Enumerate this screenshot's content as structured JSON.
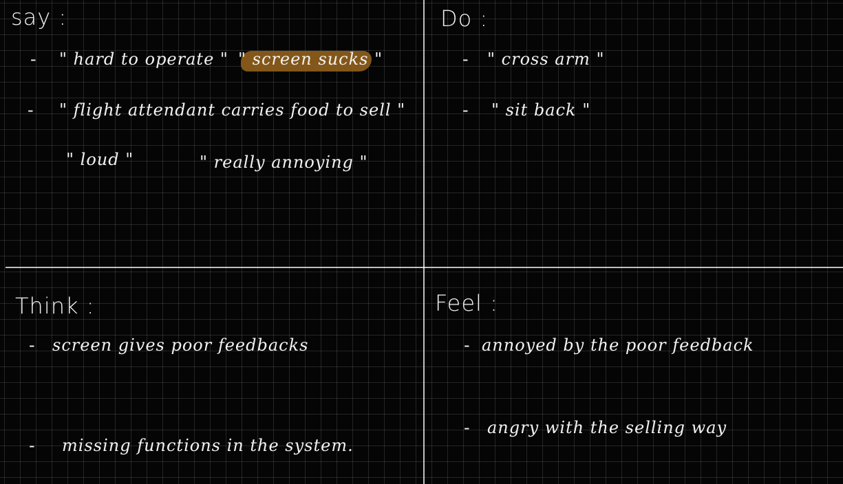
{
  "quadrants": {
    "say": {
      "heading": "say :",
      "items": [
        {
          "dash": "-",
          "text": "\" hard to operate \""
        },
        {
          "text": "\" screen sucks \""
        },
        {
          "dash": "-",
          "text": "\" flight attendant carries food to sell \""
        },
        {
          "text": "\" loud \""
        },
        {
          "text": "\" really annoying \""
        }
      ]
    },
    "do": {
      "heading": "Do :",
      "items": [
        {
          "dash": "-",
          "text": "\" cross arm \""
        },
        {
          "dash": "-",
          "text": "\" sit back \""
        }
      ]
    },
    "think": {
      "heading": "Think :",
      "items": [
        {
          "dash": "-",
          "text": "screen gives poor feedbacks"
        },
        {
          "dash": "-",
          "text": "missing functions in the system."
        }
      ]
    },
    "feel": {
      "heading": "Feel :",
      "items": [
        {
          "dash": "-",
          "text": "annoyed by the poor feedback"
        },
        {
          "dash": "-",
          "text": "angry with the selling way"
        }
      ]
    }
  },
  "colors": {
    "background": "#050505",
    "grid": "#2a2a2a",
    "ink": "#f2f2f2",
    "highlight": "#8a5c1a"
  }
}
